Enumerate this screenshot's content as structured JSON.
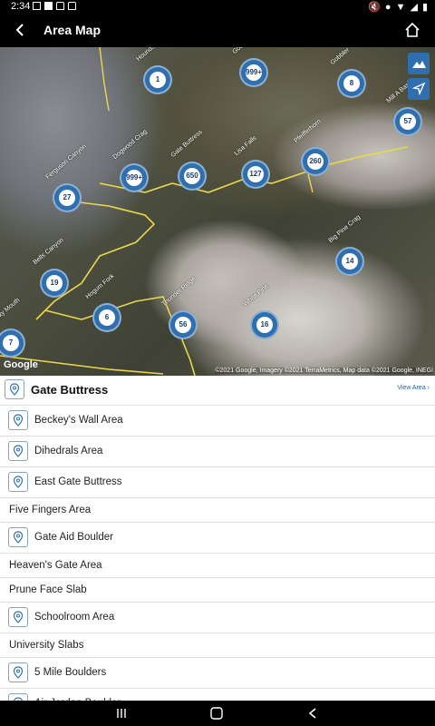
{
  "status": {
    "time": "2:34"
  },
  "appbar": {
    "title": "Area Map"
  },
  "map": {
    "clusters": [
      {
        "name": "Hounds Tooth",
        "count": "1"
      },
      {
        "name": "Gobblers Knob",
        "count": "999+"
      },
      {
        "name": "Gobbler",
        "count": "8"
      },
      {
        "name": "Mill A Basin",
        "count": "57"
      },
      {
        "name": "Dogwood Crag",
        "count": "999+"
      },
      {
        "name": "Gate Buttress",
        "count": "650"
      },
      {
        "name": "Lisa Falls",
        "count": "127"
      },
      {
        "name": "Pfeifferhorn",
        "count": "260"
      },
      {
        "name": "Ferguson Canyon",
        "count": "27"
      },
      {
        "name": "Big Pine Crag",
        "count": "14"
      },
      {
        "name": "Bells Canyon",
        "count": "19"
      },
      {
        "name": "Hogum Fork",
        "count": "6"
      },
      {
        "name": "Thunder Ridge",
        "count": "56"
      },
      {
        "name": "White Pine",
        "count": "16"
      },
      {
        "name": "Rocky Mouth",
        "count": "7"
      }
    ],
    "google": "Google",
    "attribution": "©2021 Google, Imagery ©2021 TerraMetrics, Map data ©2021 Google, INEGI"
  },
  "panel": {
    "title": "Gate Buttress",
    "view_area": "View Area ›",
    "items": [
      {
        "label": "Beckey's Wall Area",
        "pin": true
      },
      {
        "label": "Dihedrals Area",
        "pin": true
      },
      {
        "label": "East Gate Buttress",
        "pin": true
      },
      {
        "label": "Five Fingers Area",
        "pin": false
      },
      {
        "label": "Gate Aid Boulder",
        "pin": true
      },
      {
        "label": "Heaven's Gate Area",
        "pin": false
      },
      {
        "label": "Prune Face Slab",
        "pin": false
      },
      {
        "label": "Schoolroom Area",
        "pin": true
      },
      {
        "label": "University Slabs",
        "pin": false
      },
      {
        "label": "5 Mile Boulders",
        "pin": true
      },
      {
        "label": "Air Jordan Boulder",
        "pin": true
      }
    ]
  }
}
